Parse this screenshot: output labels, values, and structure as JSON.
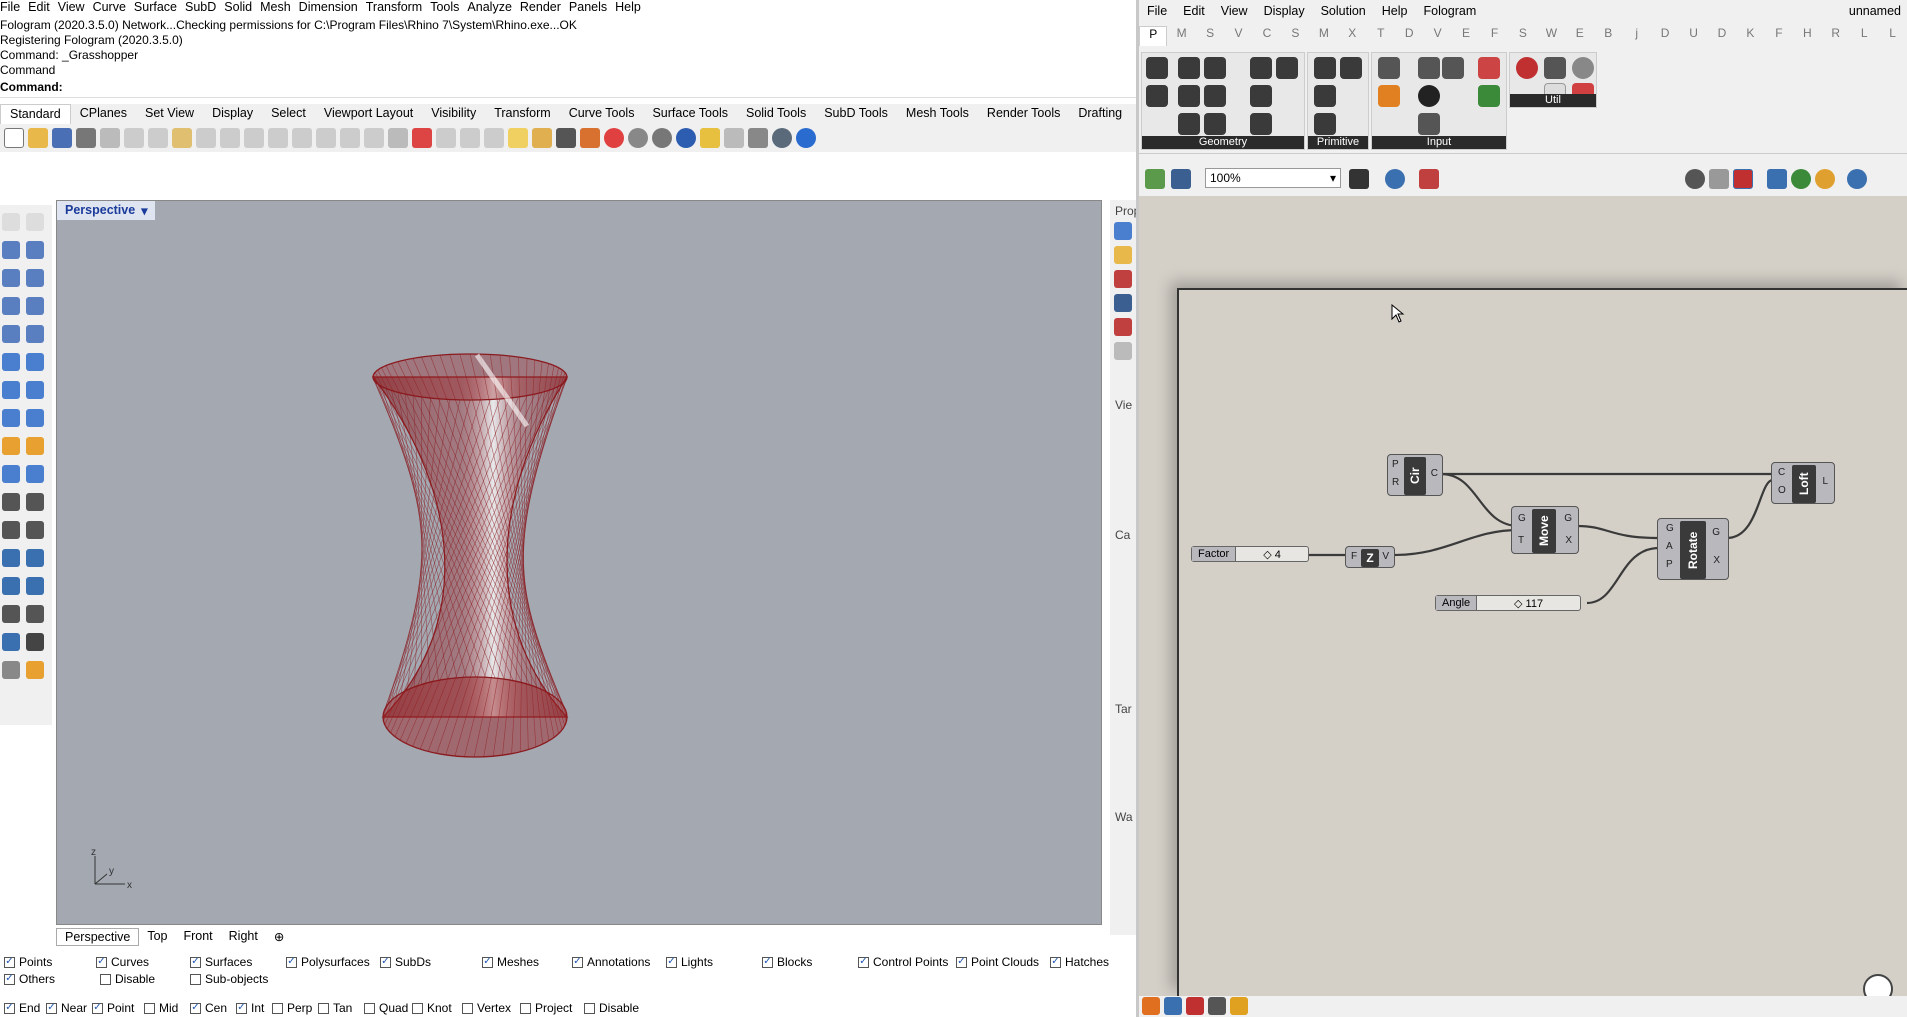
{
  "rhino": {
    "menu": [
      "File",
      "Edit",
      "View",
      "Curve",
      "Surface",
      "SubD",
      "Solid",
      "Mesh",
      "Dimension",
      "Transform",
      "Tools",
      "Analyze",
      "Render",
      "Panels",
      "Help"
    ],
    "command_history": [
      "Fologram (2020.3.5.0) Network...Checking permissions for C:\\Program Files\\Rhino 7\\System\\Rhino.exe...OK",
      "Registering Fologram (2020.3.5.0)",
      "Command: _Grasshopper",
      "Command"
    ],
    "command_prompt": "Command:",
    "toolbar_tabs": [
      "Standard",
      "CPlanes",
      "Set View",
      "Display",
      "Select",
      "Viewport Layout",
      "Visibility",
      "Transform",
      "Curve Tools",
      "Surface Tools",
      "Solid Tools",
      "SubD Tools",
      "Mesh Tools",
      "Render Tools",
      "Drafting"
    ],
    "viewport": {
      "name": "Perspective",
      "background": "#a3a8b1",
      "axis_labels": {
        "z": "z",
        "y": "y",
        "x": "x"
      }
    },
    "viewport_tabs": [
      "Perspective",
      "Top",
      "Front",
      "Right"
    ],
    "viewport_tab_add": "⊕",
    "right_panel_labels": [
      "Prop",
      "Vie",
      "Ca",
      "Tar",
      "Wa"
    ],
    "filters_row1": [
      {
        "label": "Points",
        "checked": true
      },
      {
        "label": "Curves",
        "checked": true
      },
      {
        "label": "Surfaces",
        "checked": true
      },
      {
        "label": "Polysurfaces",
        "checked": true
      },
      {
        "label": "SubDs",
        "checked": true
      },
      {
        "label": "Meshes",
        "checked": true
      },
      {
        "label": "Annotations",
        "checked": true
      },
      {
        "label": "Lights",
        "checked": true
      },
      {
        "label": "Blocks",
        "checked": true
      },
      {
        "label": "Control Points",
        "checked": true
      },
      {
        "label": "Point Clouds",
        "checked": true
      },
      {
        "label": "Hatches",
        "checked": true
      }
    ],
    "filters_row2": [
      {
        "label": "Others",
        "checked": true
      },
      {
        "label": "Disable",
        "checked": false
      },
      {
        "label": "Sub-objects",
        "checked": false
      }
    ],
    "osnaps": [
      {
        "label": "End",
        "checked": true
      },
      {
        "label": "Near",
        "checked": true
      },
      {
        "label": "Point",
        "checked": true
      },
      {
        "label": "Mid",
        "checked": false
      },
      {
        "label": "Cen",
        "checked": true
      },
      {
        "label": "Int",
        "checked": true
      },
      {
        "label": "Perp",
        "checked": false
      },
      {
        "label": "Tan",
        "checked": false
      },
      {
        "label": "Quad",
        "checked": false
      },
      {
        "label": "Knot",
        "checked": false
      },
      {
        "label": "Vertex",
        "checked": false
      },
      {
        "label": "Project",
        "checked": false
      },
      {
        "label": "Disable",
        "checked": false
      }
    ]
  },
  "grasshopper": {
    "menu": [
      "File",
      "Edit",
      "View",
      "Display",
      "Solution",
      "Help",
      "Fologram"
    ],
    "doc_title": "unnamed",
    "tabs": [
      "P",
      "M",
      "S",
      "V",
      "C",
      "S",
      "M",
      "X",
      "T",
      "D",
      "V",
      "E",
      "F",
      "S",
      "W",
      "E",
      "B",
      "j",
      "D",
      "U",
      "D",
      "K",
      "F",
      "H",
      "R",
      "L",
      "L"
    ],
    "active_tab": "P",
    "ribbon_groups": [
      "Geometry",
      "Primitive",
      "Input",
      "Util"
    ],
    "zoom": "100%",
    "components": {
      "circle": {
        "name": "Cir",
        "inputs": [
          "P",
          "R"
        ],
        "outputs": [
          "C"
        ]
      },
      "move": {
        "name": "Move",
        "inputs": [
          "G",
          "T"
        ],
        "outputs": [
          "G",
          "X"
        ]
      },
      "unitz": {
        "name": "Z",
        "inputs": [
          "F"
        ],
        "outputs": [
          "V"
        ]
      },
      "rotate": {
        "name": "Rotate",
        "inputs": [
          "G",
          "A",
          "P"
        ],
        "outputs": [
          "G",
          "X"
        ]
      },
      "loft": {
        "name": "Loft",
        "inputs": [
          "C",
          "O"
        ],
        "outputs": [
          "L"
        ]
      }
    },
    "sliders": {
      "factor": {
        "name": "Factor",
        "value": "4"
      },
      "angle": {
        "name": "Angle",
        "value": "117"
      }
    }
  },
  "colors": {
    "surface": "#9b1d20",
    "wire": "#303030",
    "canvas": "#d4d0c8",
    "viewport_label": "#1a3b9a"
  }
}
